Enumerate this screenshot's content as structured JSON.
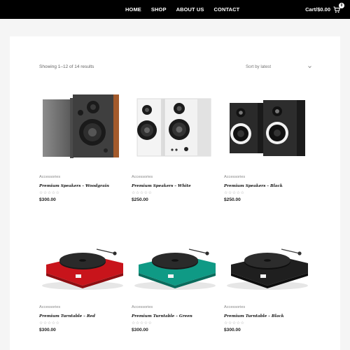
{
  "header": {
    "nav": [
      "HOME",
      "SHOP",
      "ABOUT US",
      "CONTACT"
    ],
    "cart_label": "Cart/$0.00",
    "cart_count": "0"
  },
  "shop": {
    "result_count": "Showing 1–12 of 14 results",
    "sort_selected": "Sort by latest"
  },
  "products": [
    {
      "category": "Accessories",
      "title": "Premium Speakers – Woodgrain",
      "price": "$300.00",
      "rating": 0,
      "image": "speakers-woodgrain",
      "colors": {
        "main": "#8a4a22"
      }
    },
    {
      "category": "Accessories",
      "title": "Premium Speakers – White",
      "price": "$250.00",
      "rating": 0,
      "image": "speakers-white",
      "colors": {
        "main": "#f2f2f2"
      }
    },
    {
      "category": "Accessories",
      "title": "Premium Speakers – Black",
      "price": "$250.00",
      "rating": 0,
      "image": "speakers-black",
      "colors": {
        "main": "#222222"
      }
    },
    {
      "category": "Accessories",
      "title": "Premium Turntable – Red",
      "price": "$300.00",
      "rating": 0,
      "image": "turntable-red",
      "colors": {
        "main": "#c8141b"
      }
    },
    {
      "category": "Accessories",
      "title": "Premium Turntable – Green",
      "price": "$300.00",
      "rating": 0,
      "image": "turntable-green",
      "colors": {
        "main": "#0f9a85"
      }
    },
    {
      "category": "Accessories",
      "title": "Premium Turntable – Black",
      "price": "$300.00",
      "rating": 0,
      "image": "turntable-black",
      "colors": {
        "main": "#1c1c1c"
      }
    }
  ],
  "colors": {
    "header_bg": "#000000",
    "page_bg": "#f5f5f5",
    "panel_bg": "#ffffff"
  }
}
